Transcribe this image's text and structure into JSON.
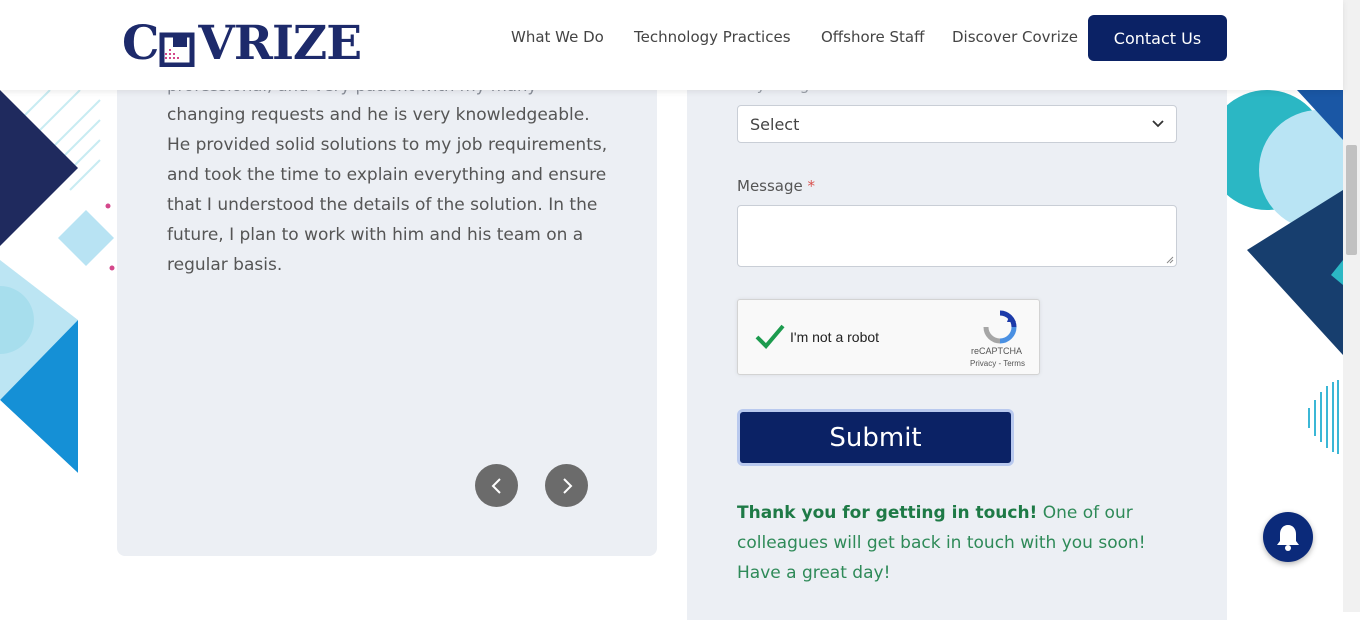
{
  "header": {
    "logo_text_left": "C",
    "logo_text_right": "VRIZE",
    "nav": [
      "What We Do",
      "Technology Practices",
      "Offshore Staff",
      "Discover Covrize"
    ],
    "contact_label": "Contact Us"
  },
  "testimonial": {
    "faded_line": "professional, and very patient with my many",
    "text": "changing requests and he is very knowledgeable. He provided solid solutions to my job requirements, and took the time to explain everything and ensure that I understood the details of the solution. In the future, I plan to work with him and his team on a regular basis."
  },
  "form": {
    "select_label_partial": "Any Budget",
    "select_value": "Select",
    "message_label": "Message",
    "required_mark": "*",
    "recaptcha_label": "I'm not a robot",
    "recaptcha_brand": "reCAPTCHA",
    "recaptcha_links": "Privacy - Terms",
    "submit_label": "Submit",
    "thanks_bold": "Thank you for getting in touch!",
    "thanks_rest": " One of our colleagues will get back in touch with you soon! Have a great day!"
  },
  "colors": {
    "brand_navy": "#0b2265",
    "success_green": "#2e8a58",
    "card_bg": "#eceff4"
  }
}
